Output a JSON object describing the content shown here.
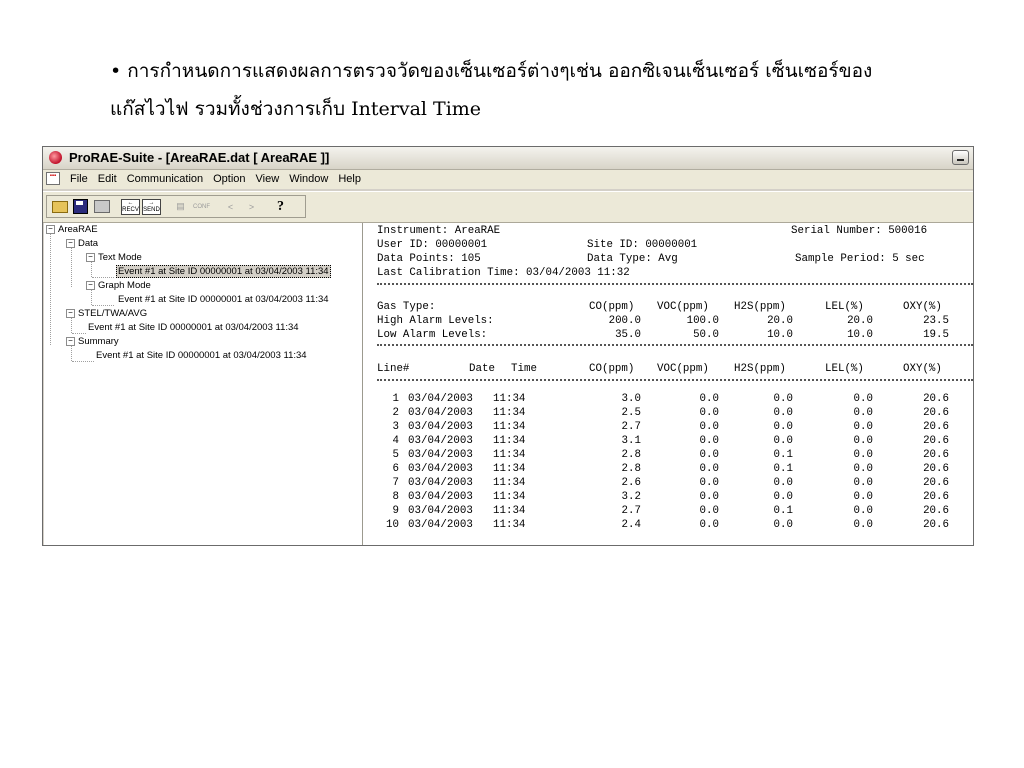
{
  "caption": {
    "line1": "• การกำหนดการแสดงผลการตรวจวัดของเซ็นเซอร์ต่างๆเช่น ออกซิเจนเซ็นเซอร์ เซ็นเซอร์ของ",
    "line2": "แก๊สไวไฟ รวมทั้งช่วงการเก็บ Interval Time"
  },
  "window": {
    "title": "ProRAE-Suite - [AreaRAE.dat    [ AreaRAE ]]",
    "menu": [
      "File",
      "Edit",
      "Communication",
      "Option",
      "View",
      "Window",
      "Help"
    ],
    "toolbar": [
      "open-icon",
      "save-icon",
      "print-icon",
      "receive-icon",
      "send-icon",
      "copy-icon",
      "config-icon",
      "prev-icon",
      "next-icon",
      "help-icon"
    ],
    "toolbar_text": {
      "recv": "RECV",
      "send": "SEND",
      "conf": "CONF",
      "prev": "<",
      "next": ">",
      "help": "?"
    }
  },
  "tree": {
    "root": "AreaRAE",
    "data": "Data",
    "text_mode": "Text Mode",
    "text_mode_event": "Event #1 at Site ID 00000001 at 03/04/2003 11:34",
    "graph_mode": "Graph Mode",
    "graph_mode_event": "Event #1 at Site ID 00000001 at 03/04/2003 11:34",
    "stel": "STEL/TWA/AVG",
    "stel_event": "Event #1 at Site ID 00000001 at 03/04/2003 11:34",
    "summary": "Summary",
    "summary_event": "Event #1 at Site ID 00000001 at 03/04/2003 11:34"
  },
  "report": {
    "instrument": "Instrument: AreaRAE",
    "serial": "Serial Number: 500016",
    "user_id": "User ID: 00000001",
    "site_id": "Site ID: 00000001",
    "data_points": "Data Points: 105",
    "data_type": "Data Type: Avg",
    "sample_period": "Sample Period: 5 sec",
    "last_cal": "Last Calibration Time: 03/04/2003 11:32",
    "gas_type_label": "Gas Type:",
    "high_label": "High Alarm Levels:",
    "low_label": "Low Alarm Levels:",
    "gases": [
      "CO(ppm)",
      "VOC(ppm)",
      "H2S(ppm)",
      "LEL(%)",
      "OXY(%)"
    ],
    "high_alarm": [
      "200.0",
      "100.0",
      "20.0",
      "20.0",
      "23.5"
    ],
    "low_alarm": [
      "35.0",
      "50.0",
      "10.0",
      "10.0",
      "19.5"
    ],
    "col_line": "Line#",
    "col_date": "Date",
    "col_time": "Time",
    "rows": [
      [
        "1",
        "03/04/2003",
        "11:34",
        "3.0",
        "0.0",
        "0.0",
        "0.0",
        "20.6"
      ],
      [
        "2",
        "03/04/2003",
        "11:34",
        "2.5",
        "0.0",
        "0.0",
        "0.0",
        "20.6"
      ],
      [
        "3",
        "03/04/2003",
        "11:34",
        "2.7",
        "0.0",
        "0.0",
        "0.0",
        "20.6"
      ],
      [
        "4",
        "03/04/2003",
        "11:34",
        "3.1",
        "0.0",
        "0.0",
        "0.0",
        "20.6"
      ],
      [
        "5",
        "03/04/2003",
        "11:34",
        "2.8",
        "0.0",
        "0.1",
        "0.0",
        "20.6"
      ],
      [
        "6",
        "03/04/2003",
        "11:34",
        "2.8",
        "0.0",
        "0.1",
        "0.0",
        "20.6"
      ],
      [
        "7",
        "03/04/2003",
        "11:34",
        "2.6",
        "0.0",
        "0.0",
        "0.0",
        "20.6"
      ],
      [
        "8",
        "03/04/2003",
        "11:34",
        "3.2",
        "0.0",
        "0.0",
        "0.0",
        "20.6"
      ],
      [
        "9",
        "03/04/2003",
        "11:34",
        "2.7",
        "0.0",
        "0.1",
        "0.0",
        "20.6"
      ],
      [
        "10",
        "03/04/2003",
        "11:34",
        "2.4",
        "0.0",
        "0.0",
        "0.0",
        "20.6"
      ]
    ]
  }
}
